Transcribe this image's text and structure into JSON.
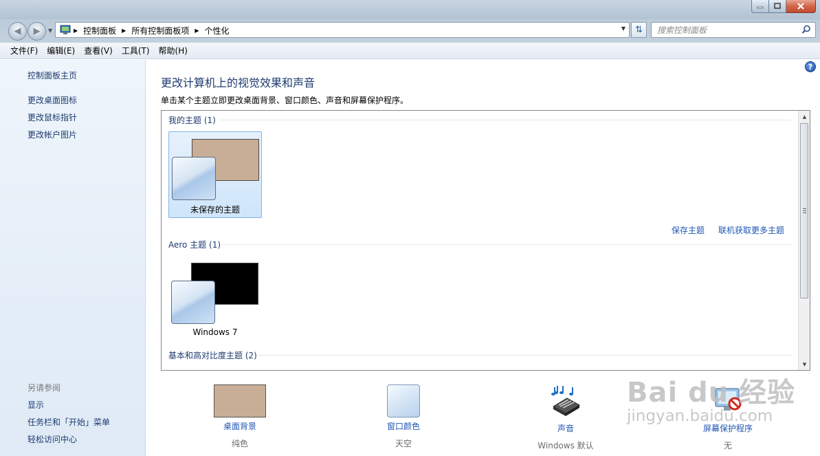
{
  "window": {
    "title_buttons": [
      "minimize",
      "maximize",
      "close"
    ]
  },
  "address_bar": {
    "crumbs": [
      "控制面板",
      "所有控制面板项",
      "个性化"
    ]
  },
  "search": {
    "placeholder": "搜索控制面板"
  },
  "menu": [
    "文件(F)",
    "编辑(E)",
    "查看(V)",
    "工具(T)",
    "帮助(H)"
  ],
  "sidebar": {
    "links": [
      "控制面板主页",
      "更改桌面图标",
      "更改鼠标指针",
      "更改帐户图片"
    ],
    "see_also_heading": "另请参阅",
    "see_also": [
      "显示",
      "任务栏和「开始」菜单",
      "轻松访问中心"
    ]
  },
  "main": {
    "title": "更改计算机上的视觉效果和声音",
    "description": "单击某个主题立即更改桌面背景、窗口颜色、声音和屏幕保护程序。",
    "groups": [
      {
        "heading": "我的主题 (1)",
        "themes": [
          {
            "name": "未保存的主题",
            "bg_color": "#c8ae96",
            "selected": true
          }
        ]
      },
      {
        "heading": "Aero 主题 (1)",
        "themes": [
          {
            "name": "Windows 7",
            "bg_color": "#000000",
            "selected": false
          }
        ]
      },
      {
        "heading": "基本和高对比度主题 (2)",
        "themes": []
      }
    ],
    "save_theme_link": "保存主题",
    "get_more_link": "联机获取更多主题"
  },
  "options": [
    {
      "label": "桌面背景",
      "value": "纯色",
      "icon": "desktop-background-swatch"
    },
    {
      "label": "窗口颜色",
      "value": "天空",
      "icon": "window-color-swatch"
    },
    {
      "label": "声音",
      "value": "Windows 默认",
      "icon": "sound-icon"
    },
    {
      "label": "屏幕保护程序",
      "value": "无",
      "icon": "screensaver-icon"
    }
  ],
  "watermark": {
    "logo": "Bai du 经验",
    "url": "jingyan.baidu.com"
  },
  "colors": {
    "link": "#1e56b4",
    "heading": "#1e3a6f",
    "selected_tile": "#cfe5fb"
  }
}
